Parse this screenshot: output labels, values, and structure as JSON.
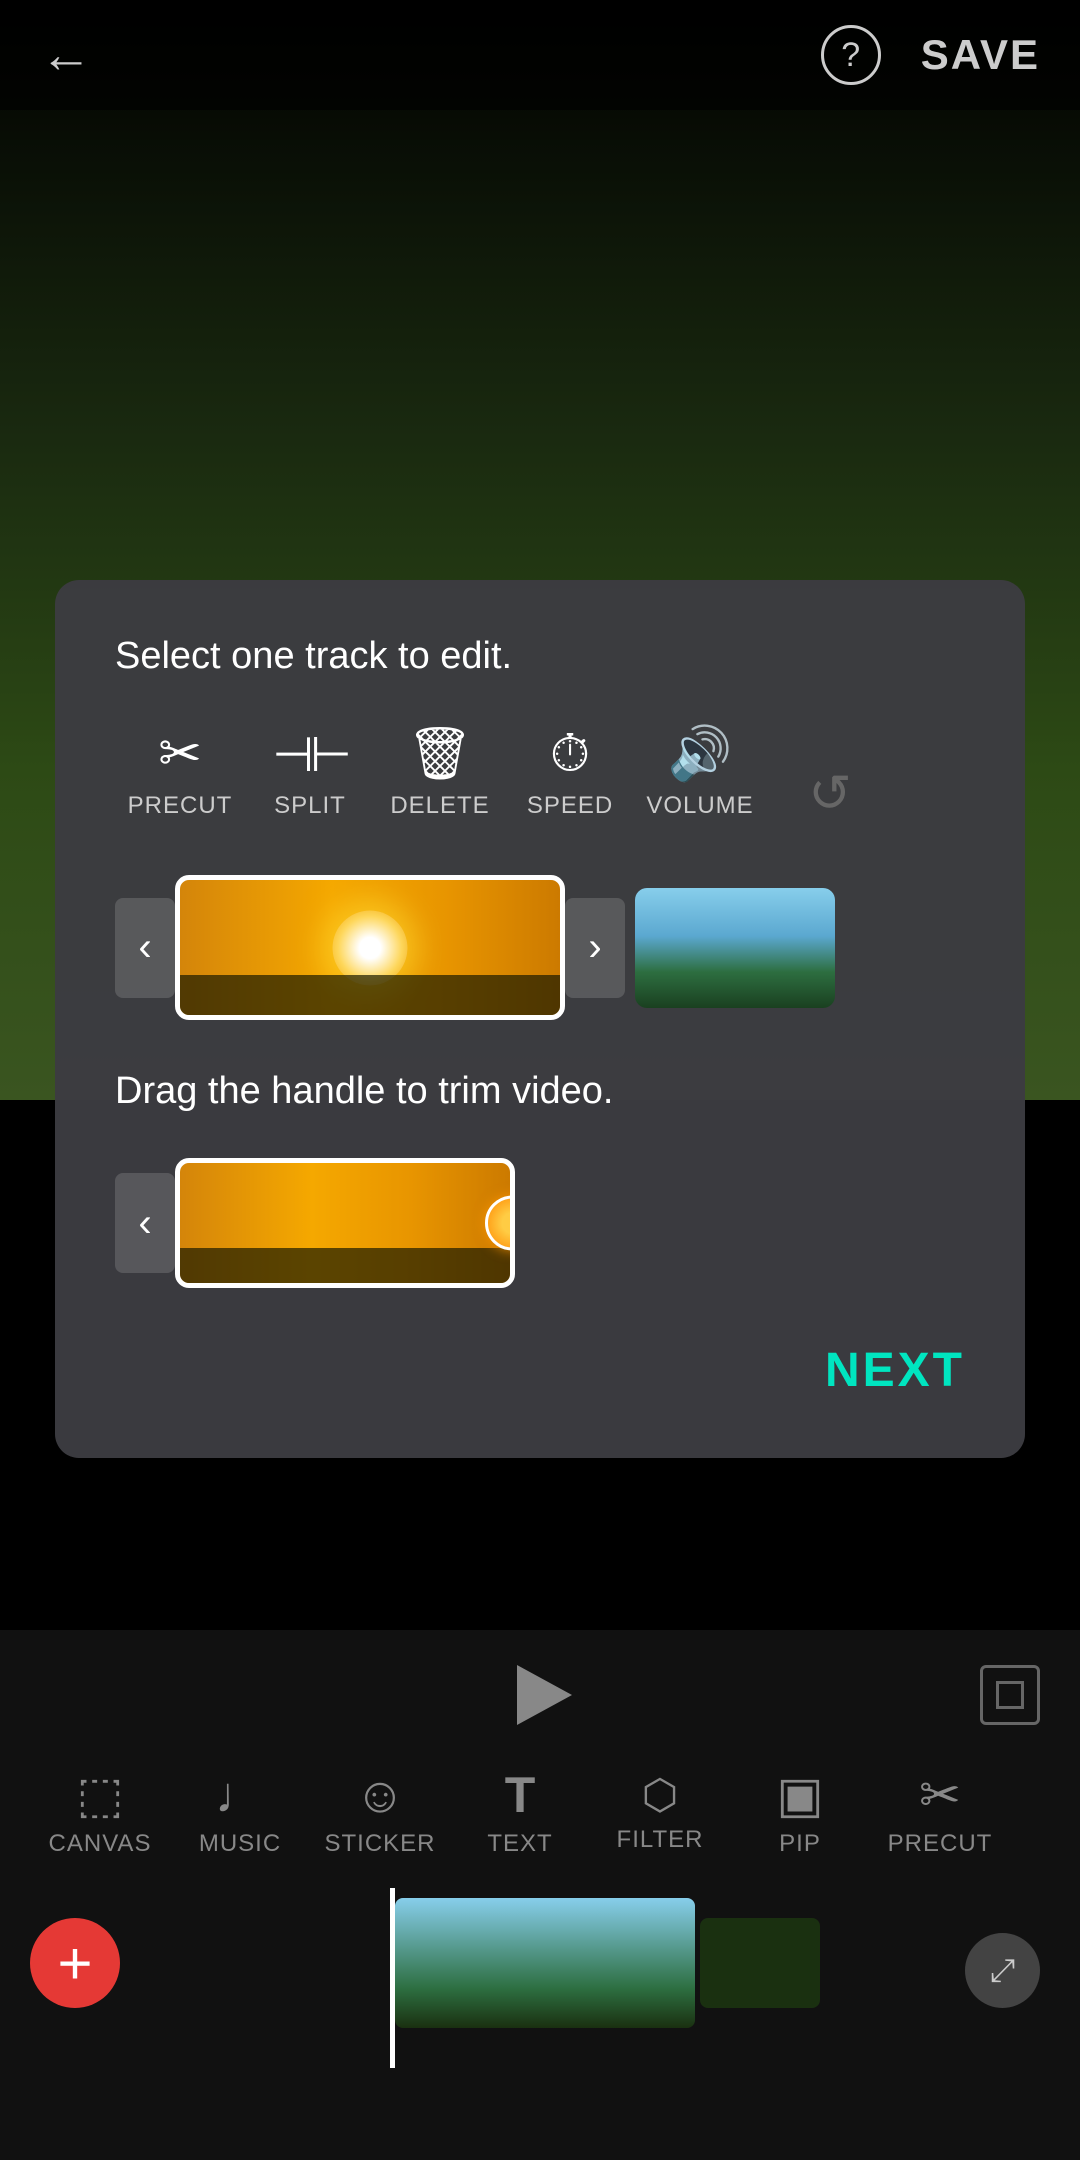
{
  "header": {
    "back_label": "←",
    "help_label": "?",
    "save_label": "SAVE"
  },
  "modal": {
    "title": "Select one track to edit.",
    "tools": [
      {
        "id": "precut",
        "icon": "✂",
        "label": "PRECUT",
        "disabled": false
      },
      {
        "id": "split",
        "icon": "⊣⊢",
        "label": "SPLIT",
        "disabled": false
      },
      {
        "id": "delete",
        "icon": "🗑",
        "label": "DELETE",
        "disabled": false
      },
      {
        "id": "speed",
        "icon": "⏱",
        "label": "SPEED",
        "disabled": false
      },
      {
        "id": "volume",
        "icon": "🔊",
        "label": "VOLUME",
        "disabled": false
      },
      {
        "id": "rotate",
        "icon": "↺",
        "label": "",
        "disabled": true
      }
    ],
    "trim_instruction": "Drag the handle to trim video.",
    "next_label": "NEXT"
  },
  "bottom": {
    "toolbar_items": [
      {
        "id": "canvas",
        "icon": "⬚",
        "label": "CANVAS"
      },
      {
        "id": "music",
        "icon": "♩",
        "label": "MUSIC"
      },
      {
        "id": "sticker",
        "icon": "☺",
        "label": "STICKER"
      },
      {
        "id": "text",
        "icon": "T",
        "label": "TEXT"
      },
      {
        "id": "filter",
        "icon": "⬡",
        "label": "FILTER"
      },
      {
        "id": "pip",
        "icon": "▣",
        "label": "PIP"
      },
      {
        "id": "precut",
        "icon": "✂",
        "label": "PRECUT"
      }
    ]
  },
  "colors": {
    "accent": "#00e5c0",
    "add_btn": "#e53935",
    "active_border": "#ffffff",
    "bg_modal": "rgba(60,60,65,0.97)"
  }
}
